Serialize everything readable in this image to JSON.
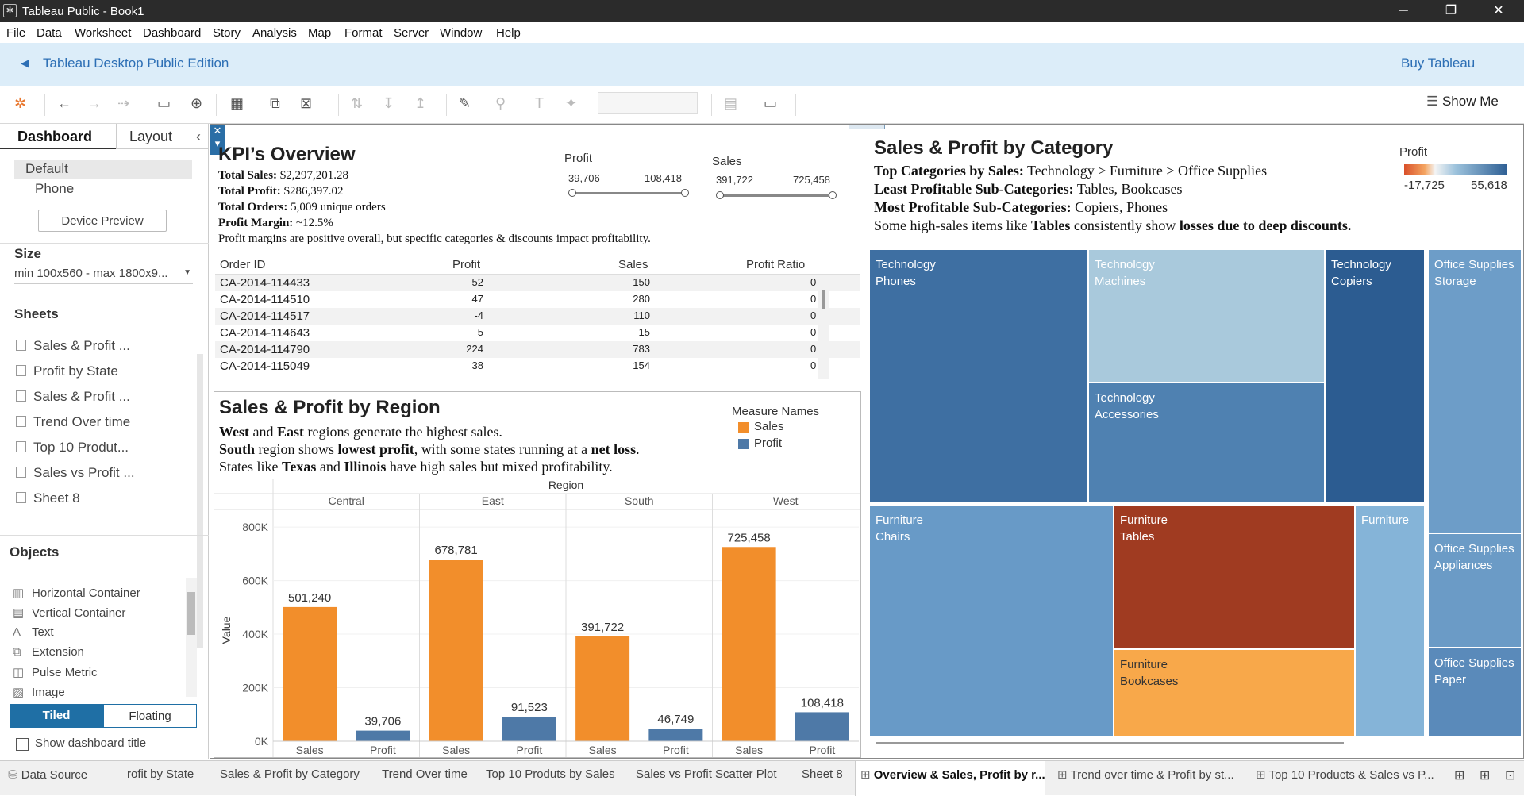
{
  "window": {
    "title": "Tableau Public - Book1",
    "minimize": "─",
    "restore": "❐",
    "close": "✕"
  },
  "menu": [
    "File",
    "Data",
    "Worksheet",
    "Dashboard",
    "Story",
    "Analysis",
    "Map",
    "Format",
    "Server",
    "Window",
    "Help"
  ],
  "banner": {
    "title": "Tableau Desktop Public Edition",
    "buy": "Buy Tableau"
  },
  "toolbar": {
    "show_me": "Show Me"
  },
  "left_pane": {
    "tabs": {
      "dashboard": "Dashboard",
      "layout": "Layout"
    },
    "device": {
      "default": "Default",
      "phone": "Phone",
      "preview_button": "Device Preview"
    },
    "size": {
      "heading": "Size",
      "value": "min 100x560 - max 1800x9..."
    },
    "sheets_heading": "Sheets",
    "sheets": [
      "Sales & Profit ...",
      "Profit by State",
      "Sales & Profit ...",
      "Trend Over time",
      "Top 10 Produt...",
      "Sales vs Profit ...",
      "Sheet 8"
    ],
    "objects_heading": "Objects",
    "objects": [
      {
        "label": "Horizontal Container",
        "icon": "▥"
      },
      {
        "label": "Vertical Container",
        "icon": "▤"
      },
      {
        "label": "Text",
        "icon": "A"
      },
      {
        "label": "Extension",
        "icon": "⧉"
      },
      {
        "label": "Pulse Metric",
        "icon": "◫"
      },
      {
        "label": "Image",
        "icon": "▨"
      }
    ],
    "tiled": "Tiled",
    "floating": "Floating",
    "show_title": "Show dashboard title"
  },
  "kpi": {
    "title": "KPI’s Overview",
    "lines": [
      {
        "label": "Total Sales:",
        "value": " $2,297,201.28"
      },
      {
        "label": "Total Profit:",
        "value": " $286,397.02"
      },
      {
        "label": "Total Orders:",
        "value": " 5,009 unique orders"
      },
      {
        "label": "Profit Margin:",
        "value": " ~12.5%"
      }
    ],
    "note": "Profit margins are positive overall, but specific categories & discounts impact profitability.",
    "profit_filter": {
      "label": "Profit",
      "min": "39,706",
      "max": "108,418"
    },
    "sales_filter": {
      "label": "Sales",
      "min": "391,722",
      "max": "725,458"
    }
  },
  "table": {
    "headers": [
      "Order ID",
      "Profit",
      "Sales",
      "Profit Ratio"
    ],
    "rows": [
      [
        "CA-2014-114433",
        "52",
        "150",
        "0"
      ],
      [
        "CA-2014-114510",
        "47",
        "280",
        "0"
      ],
      [
        "CA-2014-114517",
        "-4",
        "110",
        "0"
      ],
      [
        "CA-2014-114643",
        "5",
        "15",
        "0"
      ],
      [
        "CA-2014-114790",
        "224",
        "783",
        "0"
      ],
      [
        "CA-2014-115049",
        "38",
        "154",
        "0"
      ]
    ]
  },
  "region": {
    "title": "Sales & Profit by Region",
    "line1": {
      "b1": "West",
      "t1": " and ",
      "b2": "East",
      "t2": " regions generate the highest sales."
    },
    "line2": {
      "b1": "South",
      "t1": " region shows ",
      "b2": "lowest profit",
      "t2": ", with some states running at a ",
      "b3": "net loss",
      "t3": "."
    },
    "line3": {
      "t1": "States like ",
      "b1": "Texas",
      "t2": " and ",
      "b2": "Illinois",
      "t3": " have high sales but mixed profitability."
    },
    "legend": {
      "title": "Measure Names",
      "items": [
        {
          "name": "Sales",
          "color": "#f28e2b"
        },
        {
          "name": "Profit",
          "color": "#4e79a7"
        }
      ]
    }
  },
  "chart_data": {
    "type": "bar",
    "header": "Region",
    "categories": [
      "Central",
      "East",
      "South",
      "West"
    ],
    "measures": [
      "Sales",
      "Profit"
    ],
    "series": [
      {
        "name": "Sales",
        "values": [
          501240,
          678781,
          391722,
          725458
        ]
      },
      {
        "name": "Profit",
        "values": [
          39706,
          91523,
          46749,
          108418
        ]
      }
    ],
    "value_labels": {
      "Sales": [
        "501,240",
        "678,781",
        "391,722",
        "725,458"
      ],
      "Profit": [
        "39,706",
        "91,523",
        "46,749",
        "108,418"
      ]
    },
    "ylabel": "Value",
    "yticks": [
      "0K",
      "200K",
      "400K",
      "600K",
      "800K"
    ],
    "ylim": [
      0,
      830000
    ],
    "colors": {
      "Sales": "#f28e2b",
      "Profit": "#4e79a7"
    }
  },
  "category": {
    "title": "Sales & Profit by Category",
    "line1": {
      "b": "Top Categories by Sales:",
      "t": " Technology > Furniture > Office Supplies"
    },
    "line2": {
      "b": "Least Profitable Sub-Categories:",
      "t": " Tables, Bookcases"
    },
    "line3": {
      "b": "Most Profitable Sub-Categories:",
      "t": " Copiers, Phones"
    },
    "line4": {
      "t1": "Some high-sales items like ",
      "b1": "Tables",
      "t2": " consistently show ",
      "b2": "losses due to deep discounts."
    },
    "legend": {
      "title": "Profit",
      "min": "-17,725",
      "max": "55,618"
    },
    "treemap": [
      {
        "cat": "Technology",
        "sub": "Phones",
        "color": "#3e6fa2"
      },
      {
        "cat": "Technology",
        "sub": "Machines",
        "color": "#a9c9dc"
      },
      {
        "cat": "Technology",
        "sub": "Copiers",
        "color": "#2c5c91"
      },
      {
        "cat": "Technology",
        "sub": "Accessories",
        "color": "#4f81b1"
      },
      {
        "cat": "Office Supplies",
        "sub": "Storage",
        "color": "#6d9dc8"
      },
      {
        "cat": "Office Supplies",
        "sub": "Appliances",
        "color": "#6b9bc6"
      },
      {
        "cat": "Office Supplies",
        "sub": "Paper",
        "color": "#5a8aba"
      },
      {
        "cat": "Furniture",
        "sub": "Chairs",
        "color": "#689ac7"
      },
      {
        "cat": "Furniture",
        "sub": "Tables",
        "color": "#a03b21"
      },
      {
        "cat": "Furniture",
        "sub": "Bookcases",
        "color": "#f8a84a"
      },
      {
        "cat": "Furniture",
        "sub": "",
        "color": "#85b4d8"
      }
    ]
  },
  "bottom_tabs": [
    "Data Source",
    "rofit by State",
    "Sales & Profit by Category",
    "Trend Over time",
    "Top 10 Produts by Sales",
    "Sales vs Profit Scatter Plot",
    "Sheet 8",
    "Overview & Sales, Profit by r...",
    "Trend over time & Profit by st...",
    "Top 10 Products & Sales vs P..."
  ]
}
